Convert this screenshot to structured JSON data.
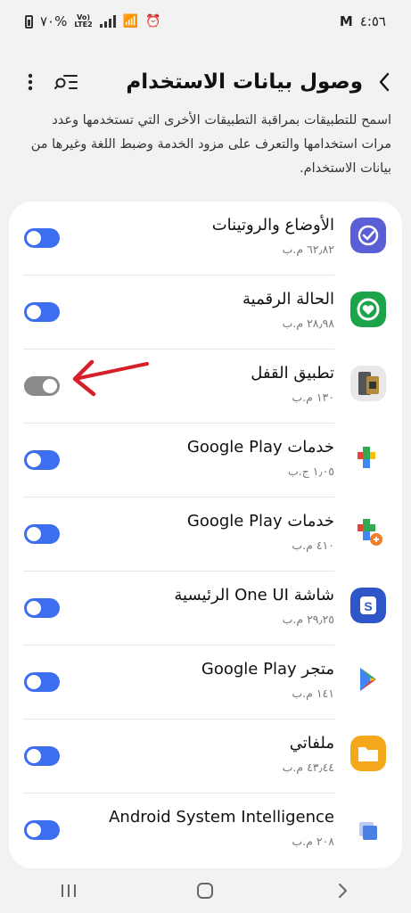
{
  "status_bar": {
    "time": "٤:٥٦",
    "battery_percent": "٧٠%",
    "network": "Vo)) LTE2"
  },
  "header": {
    "title": "وصول بيانات الاستخدام",
    "back_icon": "chevron-left-icon",
    "search_icon": "list-search-icon",
    "more_icon": "more-vert-icon"
  },
  "description": "اسمح للتطبيقات بمراقبة التطبيقات الأخرى التي تستخدمها وعدد مرات استخدامها والتعرف على مزود الخدمة وضبط اللغة وغيرها من بيانات الاستخدام.",
  "apps": [
    {
      "name": "الأوضاع والروتينات",
      "size": "٦٢٫٨٢ م.ب",
      "enabled": true,
      "icon": "modes-routines-icon",
      "color": "#5b5fd6"
    },
    {
      "name": "الحالة الرقمية",
      "size": "٢٨٫٩٨ م.ب",
      "enabled": true,
      "icon": "digital-wellbeing-icon",
      "color": "#1ba44a"
    },
    {
      "name": "تطبيق القفل",
      "size": "١٣٠ م.ب",
      "enabled": false,
      "icon": "app-lock-icon",
      "color": "#d9d9d9"
    },
    {
      "name": "خدمات Google Play",
      "size": "١٫٠٥ ج.ب",
      "enabled": true,
      "icon": "google-play-services-icon",
      "color": "#34a853"
    },
    {
      "name": "خدمات Google Play",
      "size": "٤١٠ م.ب",
      "enabled": true,
      "icon": "google-play-services-update-icon",
      "color": "#34a853"
    },
    {
      "name": "شاشة One UI الرئيسية",
      "size": "٢٩٫٢٥ م.ب",
      "enabled": true,
      "icon": "one-ui-home-icon",
      "color": "#2f56c9"
    },
    {
      "name": "متجر Google Play",
      "size": "١٤١ م.ب",
      "enabled": true,
      "icon": "google-play-store-icon",
      "color": "#ffffff"
    },
    {
      "name": "ملفاتي",
      "size": "٤٣٫٤٤ م.ب",
      "enabled": true,
      "icon": "my-files-icon",
      "color": "#f4a81c"
    },
    {
      "name": "Android System Intelligence",
      "size": "٢٠٨ م.ب",
      "enabled": true,
      "icon": "android-system-intelligence-icon",
      "color": "#4a7fe3"
    }
  ],
  "colors": {
    "toggle_on": "#3d6ef0",
    "toggle_off": "#8a8a8a",
    "annotation_arrow": "#d61f26"
  }
}
